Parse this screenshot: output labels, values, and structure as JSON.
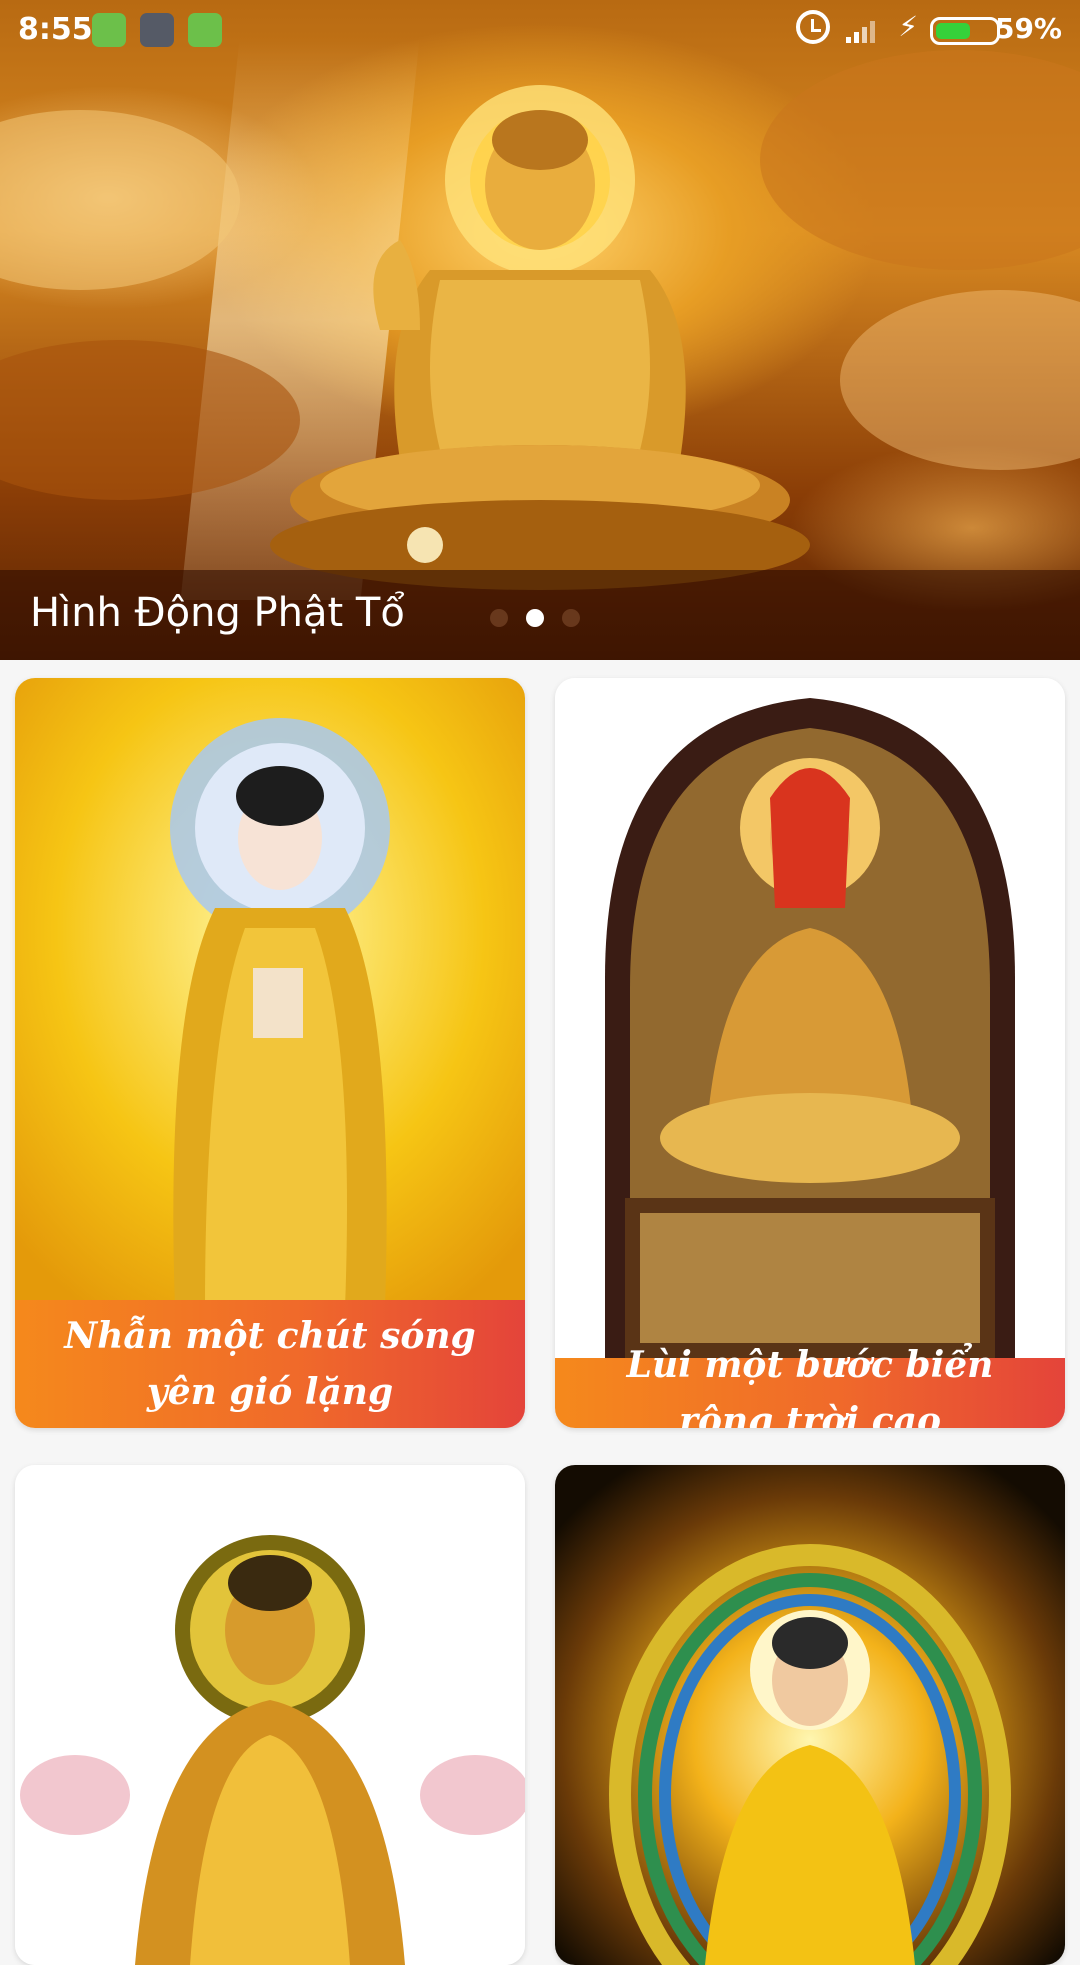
{
  "status_bar": {
    "time": "8:55",
    "battery_percent": "59%",
    "battery_level": 0.59
  },
  "hero": {
    "title": "Hình Động Phật Tổ",
    "active_slide": 1,
    "slide_count": 3
  },
  "cards": [
    {
      "caption": "Nhẫn một chút sóng yên gió lặng"
    },
    {
      "caption": "Lùi một bước biển rộng trời cao"
    },
    {
      "caption": ""
    },
    {
      "caption": ""
    }
  ],
  "colors": {
    "caption_gradient_start": "#f5891c",
    "caption_gradient_end": "#e4443a",
    "battery_green": "#36d13a"
  }
}
